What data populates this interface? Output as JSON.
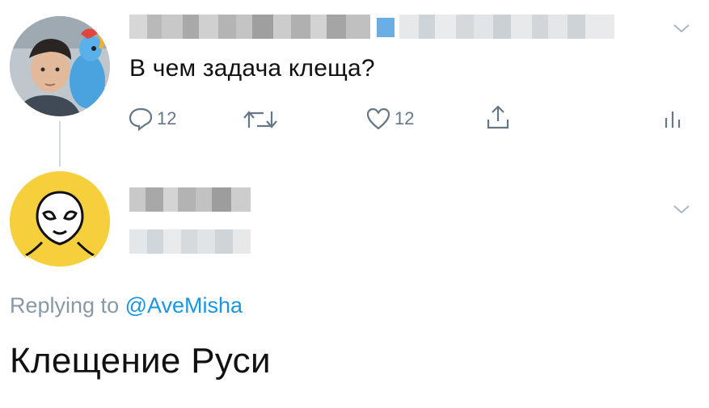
{
  "tweet": {
    "text": "В чем задача клеща?",
    "actions": {
      "reply_count": "12",
      "like_count": "12"
    }
  },
  "reply": {
    "replying_prefix": "Replying to",
    "replying_handle": "@AveMisha",
    "text": "Клещение Руси"
  },
  "icons": {
    "reply": "speech-bubble-icon",
    "retweet": "retweet-icon",
    "like": "heart-icon",
    "share": "share-icon",
    "analytics": "bar-chart-icon",
    "menu": "chevron-down-icon"
  },
  "colors": {
    "text": "#111111",
    "muted": "#8899a6",
    "link": "#1b95e0",
    "icon": "#657786",
    "avatar_yellow": "#f6cf3c"
  }
}
